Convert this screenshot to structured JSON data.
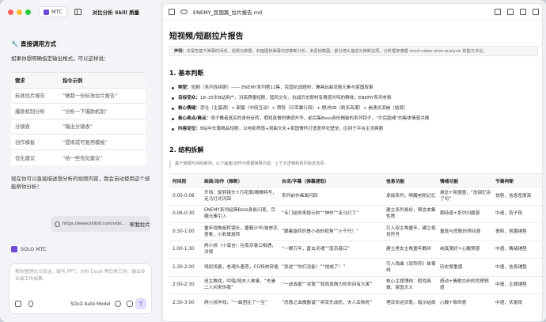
{
  "app": {
    "tag": "MTC",
    "title": "对比分析 Skill 质量",
    "colors": {
      "accent": "#6d4bd8",
      "close": "#ff5f57",
      "min": "#febc2e",
      "max": "#28c840"
    }
  },
  "chat": {
    "heading": "🔧 直接调用方式",
    "intro": "如果你想明确指定输出格式，可以这样说：",
    "table": {
      "headers": [
        "需求",
        "指令示例"
      ],
      "rows": [
        [
          "标准拉片报告",
          "“做我一份标准拉片报告”"
        ],
        [
          "爆款机制分析",
          "“分析一下爆款机制”"
        ],
        [
          "分镜表",
          "“输出分镜表”"
        ],
        [
          "创作模板",
          "“提炼成可复用模板”"
        ],
        [
          "优化建议",
          "“给一些优化建议”"
        ]
      ]
    },
    "ask": "现在你可以直接描述想分析的视频内容，我会自动使用这个技能帮你分析！",
    "user_link": "https://www.bilibili.com/vide...",
    "user_text": "帮我拉片",
    "agent_name": "SOLO MTC"
  },
  "composer": {
    "placeholder": "帮你整理论文综述、编写 PPT、分析 Excel 等日常工作。输出专业级工作成果。",
    "model": "SOLO Auto Model",
    "send": "↑"
  },
  "doc": {
    "filename": "ENEMY_民国篇_拉片报告.md",
    "title": "短视频/短剧拉片报告",
    "decl_label": "声明：",
    "decl_text": "本报告基于弹幕时间线、视频元数据、封面图和弹幕内容推断分析，未逐帧截图，部分镜头描述为推断还原。分析框架遵循 short-video-shot-analysis 技能方法论。",
    "s1_title": "1. 基本判断",
    "basics": [
      {
        "k": "类型：",
        "v": "短剧（系列连续剧）—— ENEMY系列第11集，民国抗战题材，兼具玩曲流剧元素与家国叙事"
      },
      {
        "k": "目标受众：",
        "v": "18–35岁B站用户，对高质量短剧、国风文化、抗战历史题材有情感共鸣的群体；ENEMY系列老粉"
      },
      {
        "k": "核心情绪：",
        "v": "悲壮（主基调）+ 甜蜜（中段互动）+ 愤怒（日军暴行段）+ 燃/热血（刺杀高潮）+ 崩溃式泪崩（结局）"
      },
      {
        "k": "核心卖点/爽点：",
        "v": "戏子舞者真实的身份反转，假戏真做的情感升华，前后集Boss身份揭秘的系列钩子，“尔后国魂”的集体情感共振"
      },
      {
        "k": "内容定位：",
        "v": "B站中长篇精品短剧，以电影质感+戏曲文化+家国情怀打造差异化壁垒，区别于平台主流爽剧"
      }
    ],
    "s2_title": "2. 结构拆解",
    "s2_note": "基于弹幕时间线推测，以下画面/动作为根据弹幕内容、上下文逻辑和系列信息还原。",
    "table": {
      "headers": [
        "时间段",
        "画面/动作（推断）",
        "台词/字幕（弹幕提取）",
        "信息功能",
        "情绪功能",
        "节奏判断"
      ],
      "rows": [
        [
          "0:00-0:06",
          "开场：旋转镜头+万花筒/眼睛特写，走马灯式闪回",
          "系列前作画面闪回",
          "承接系列，唤醒老粉记忆",
          "悬念+氛围感，“迭回忆杀了吗”",
          "快剪，信息密度高"
        ],
        [
          "0:06-0:30",
          "ENEMY系列经典Boss身影闪现，宗廟元素引入",
          "“专门给你来按示的”“神作”“走马灯了”",
          "建立系列身份，预告本集性质",
          "期待感+系列归属感",
          "中速，钩子段"
        ],
        [
          "0:30-1:00",
          "童年视角旋转镜头，蔓藤沙华/彼岸花意象，小彩旗旋转",
          "“跟着旋转的是小孩的视角”“小千代！”",
          "引入双主角童年，建立视觉符号",
          "童真与悲剧的预兆感",
          "慢剪，氛围铺垫"
        ],
        [
          "1:00-1:30",
          "两小孩（小溪吉）在南京巷口相遇，对视",
          "“一眼万年，直击灵魂”“南京巷口”",
          "建立男女主角童年羁绊",
          "纯真美好+心酸预感",
          "中速，情绪铺垫"
        ],
        [
          "1:30-2:00",
          "戏班场景，老魂头善恶，CG特效穿插",
          "“张进”“你们没能！”“他成了！”",
          "引入戏曲《双烈传》故事线",
          "历史厚重感",
          "中速，信息铺垫"
        ],
        [
          "2:00-2:30",
          "班主教戏，吟唱/骂夫人故事，“夫妻二人何来你我”",
          "“一送成者”“状笔”“叙戏真做为知世间有大笑”",
          "核心主题埋线：假戏真做、家国大义",
          "感动+情歌交织的哲理预感",
          "中速，主题铺垫"
        ],
        [
          "2:30-3:00",
          "两小孩学戏，“一曲团住了一生”",
          "“忽隐之血撒鄙谐”“将军先战死，夫人后殉死”",
          "埋设命运伏笔，暗示结局",
          "心酸+宿命感",
          "中速，伏笔段"
        ]
      ]
    }
  }
}
